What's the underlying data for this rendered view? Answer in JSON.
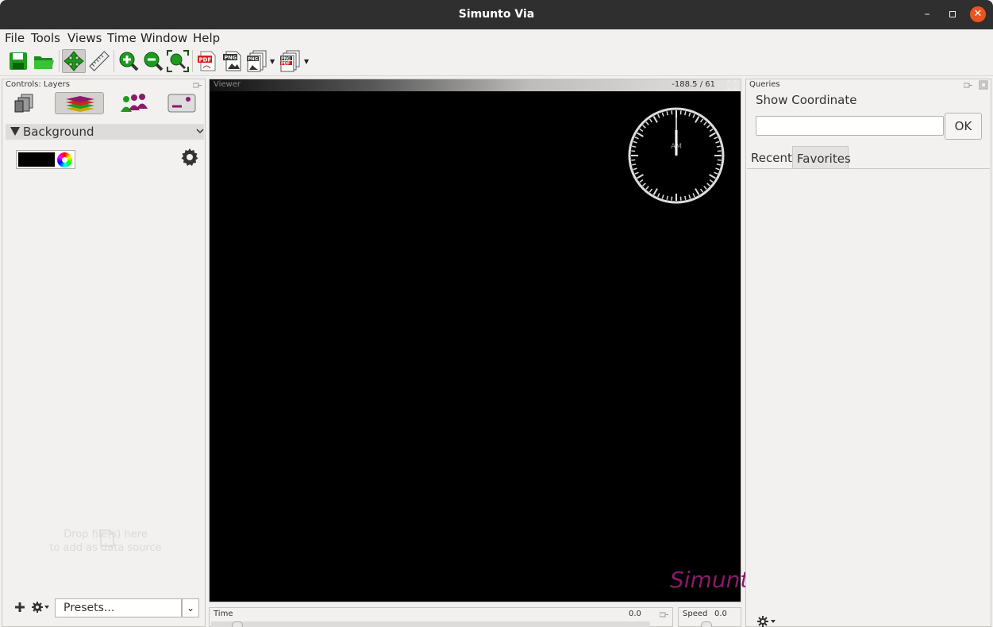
{
  "window": {
    "title": "Simunto Via",
    "minimize_label": "–",
    "close_label": "✕"
  },
  "menu": {
    "items": [
      "File",
      "Tools",
      "Views",
      "Time",
      "Window",
      "Help"
    ]
  },
  "toolbar": {
    "buttons": [
      "save-icon",
      "open-folder-icon",
      "pan-move-icon",
      "measure-ruler-icon",
      "zoom-in-icon",
      "zoom-out-icon",
      "zoom-fit-icon",
      "export-pdf-icon",
      "export-png-icon",
      "export-png-series-icon",
      "export-png-pdf-series-icon"
    ]
  },
  "layers_panel": {
    "title": "Controls: Layers",
    "section_title": "Background",
    "background_color": "#000000",
    "drop_hint_line1": "Drop file(s) here",
    "drop_hint_line2": "to add as data source",
    "presets_label": "Presets..."
  },
  "viewer": {
    "title": "Viewer",
    "coordinate": "-188.5 / 61",
    "clock_label": "AM",
    "watermark": "Simunto"
  },
  "time": {
    "label": "Time",
    "value": "0.0"
  },
  "speed": {
    "label": "Speed",
    "value": "0.0"
  },
  "queries": {
    "title": "Queries",
    "show_coordinate_label": "Show Coordinate",
    "input_value": "",
    "ok_label": "OK",
    "tabs": [
      "Recent",
      "Favorites"
    ]
  },
  "colors": {
    "accent_close": "#e95420",
    "watermark": "#8b1a6a",
    "viewer_bg": "#000000"
  }
}
